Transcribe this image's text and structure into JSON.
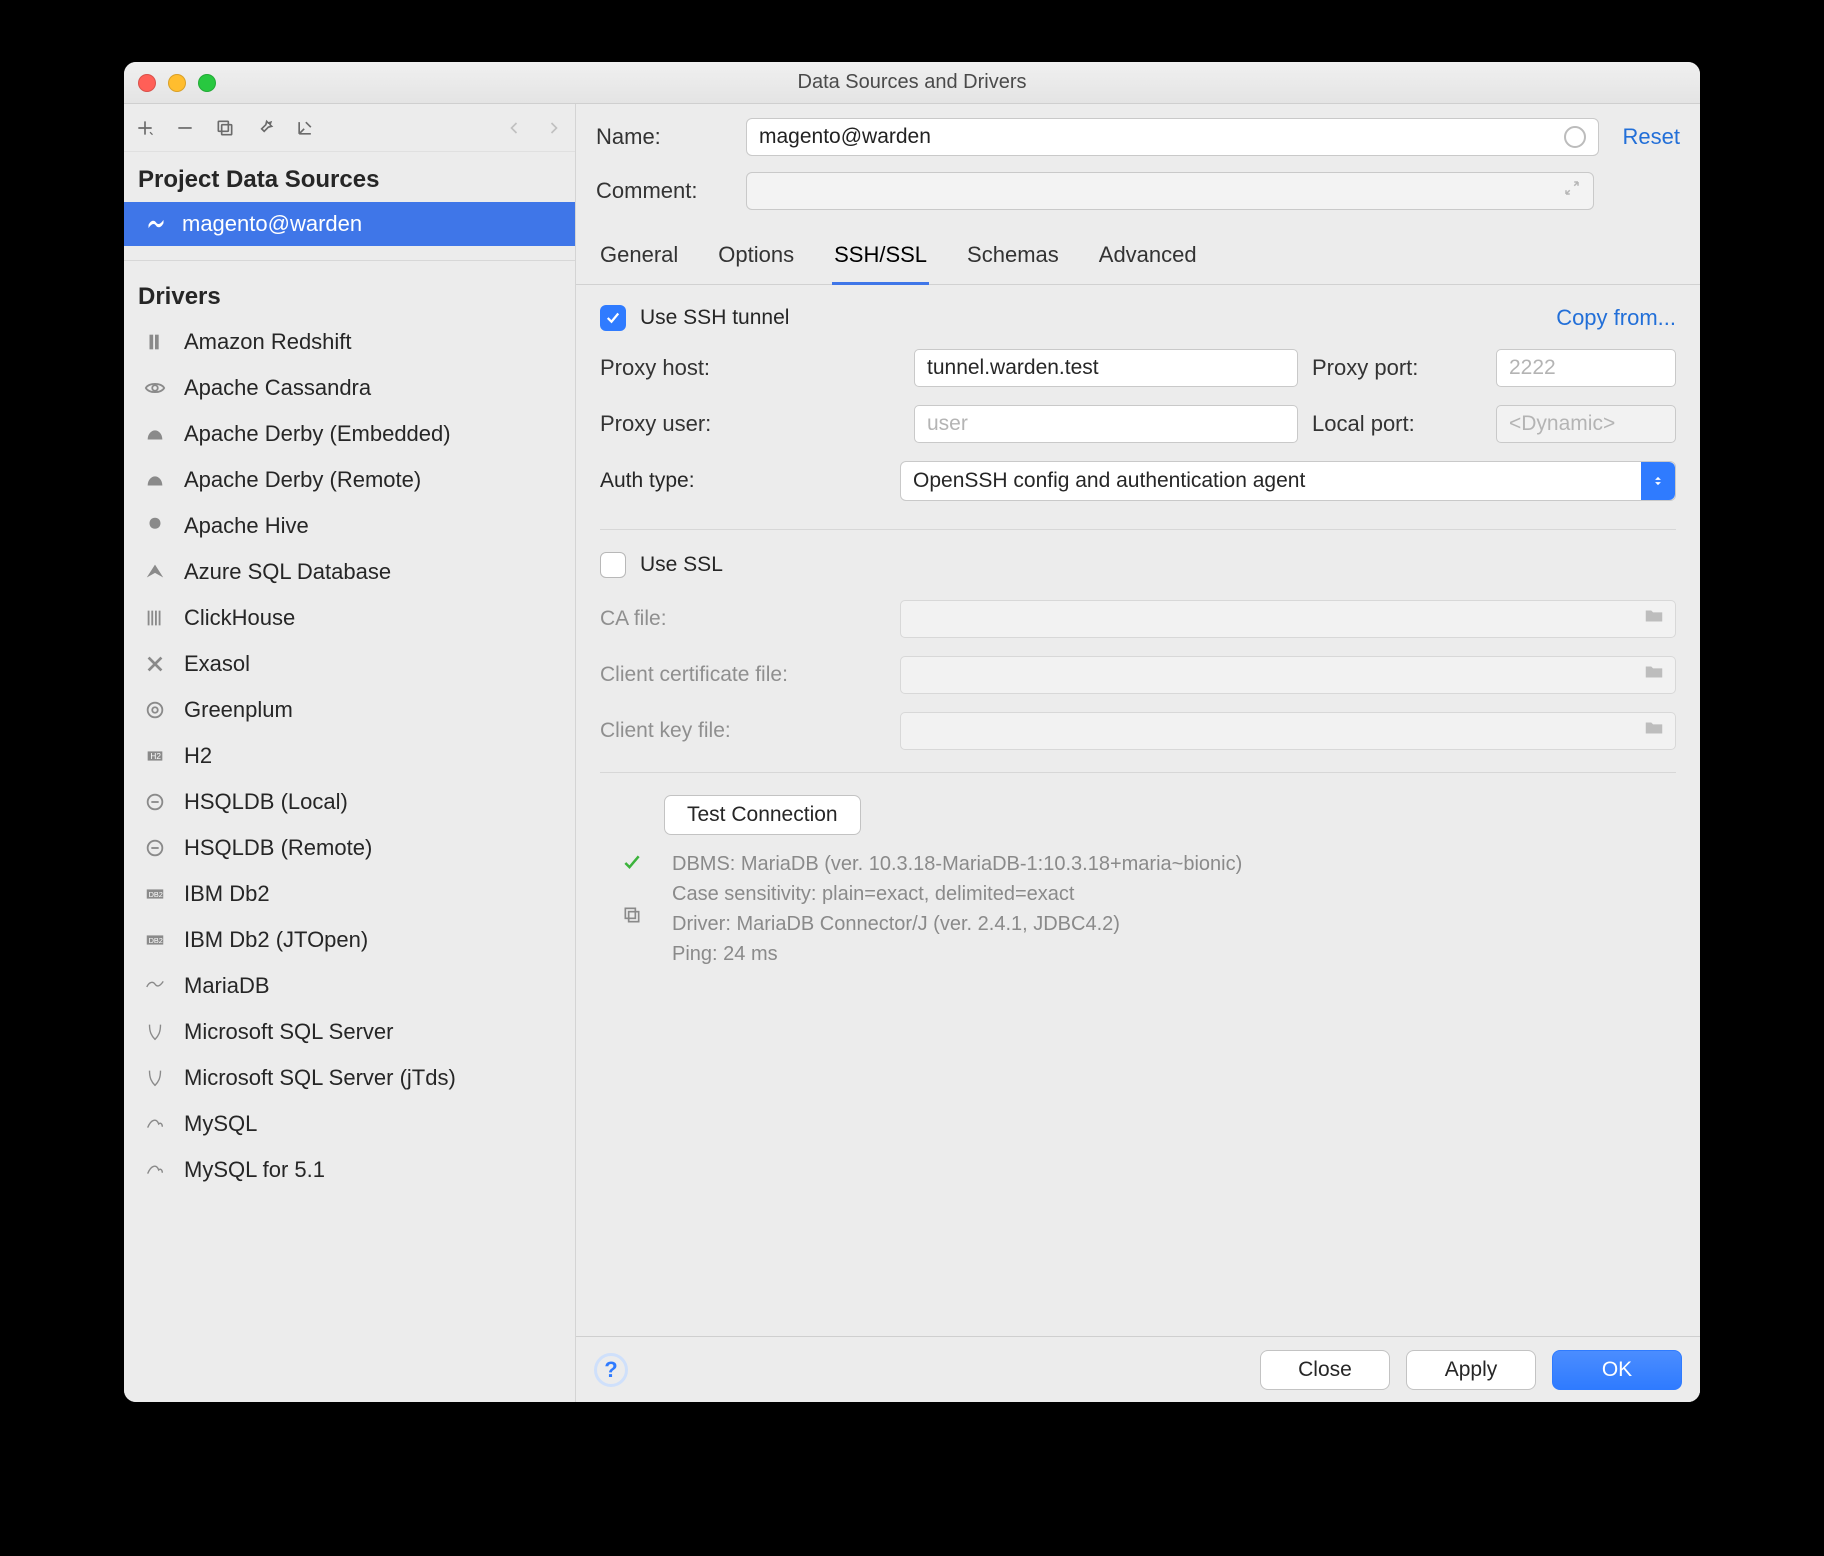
{
  "window": {
    "title": "Data Sources and Drivers"
  },
  "toolbar": {
    "add": "+",
    "remove": "−",
    "copy": "⧉",
    "wrench": "🔧",
    "import": "↙",
    "back": "←",
    "fwd": "→"
  },
  "sidebar": {
    "projectHeader": "Project Data Sources",
    "dataSource": {
      "name": "magento@warden"
    },
    "driversHeader": "Drivers",
    "drivers": [
      {
        "name": "Amazon Redshift"
      },
      {
        "name": "Apache Cassandra"
      },
      {
        "name": "Apache Derby (Embedded)"
      },
      {
        "name": "Apache Derby (Remote)"
      },
      {
        "name": "Apache Hive"
      },
      {
        "name": "Azure SQL Database"
      },
      {
        "name": "ClickHouse"
      },
      {
        "name": "Exasol"
      },
      {
        "name": "Greenplum"
      },
      {
        "name": "H2"
      },
      {
        "name": "HSQLDB (Local)"
      },
      {
        "name": "HSQLDB (Remote)"
      },
      {
        "name": "IBM Db2"
      },
      {
        "name": "IBM Db2 (JTOpen)"
      },
      {
        "name": "MariaDB"
      },
      {
        "name": "Microsoft SQL Server"
      },
      {
        "name": "Microsoft SQL Server (jTds)"
      },
      {
        "name": "MySQL"
      },
      {
        "name": "MySQL for 5.1"
      }
    ]
  },
  "form": {
    "nameLabel": "Name:",
    "nameValue": "magento@warden",
    "commentLabel": "Comment:",
    "resetLabel": "Reset"
  },
  "tabs": {
    "items": [
      "General",
      "Options",
      "SSH/SSL",
      "Schemas",
      "Advanced"
    ],
    "activeIndex": 2
  },
  "ssh": {
    "useTunnelLabel": "Use SSH tunnel",
    "copyFrom": "Copy from...",
    "proxyHostLabel": "Proxy host:",
    "proxyHost": "tunnel.warden.test",
    "proxyPortLabel": "Proxy port:",
    "proxyPort": "2222",
    "proxyUserLabel": "Proxy user:",
    "proxyUserPlaceholder": "user",
    "localPortLabel": "Local port:",
    "localPortPlaceholder": "<Dynamic>",
    "authTypeLabel": "Auth type:",
    "authType": "OpenSSH config and authentication agent"
  },
  "ssl": {
    "useSslLabel": "Use SSL",
    "caFileLabel": "CA file:",
    "clientCertLabel": "Client certificate file:",
    "clientKeyLabel": "Client key file:"
  },
  "test": {
    "button": "Test Connection",
    "line1": "DBMS: MariaDB (ver. 10.3.18-MariaDB-1:10.3.18+maria~bionic)",
    "line2": "Case sensitivity: plain=exact, delimited=exact",
    "line3": "Driver: MariaDB Connector/J (ver. 2.4.1, JDBC4.2)",
    "line4": "Ping: 24 ms"
  },
  "footer": {
    "close": "Close",
    "apply": "Apply",
    "ok": "OK"
  }
}
